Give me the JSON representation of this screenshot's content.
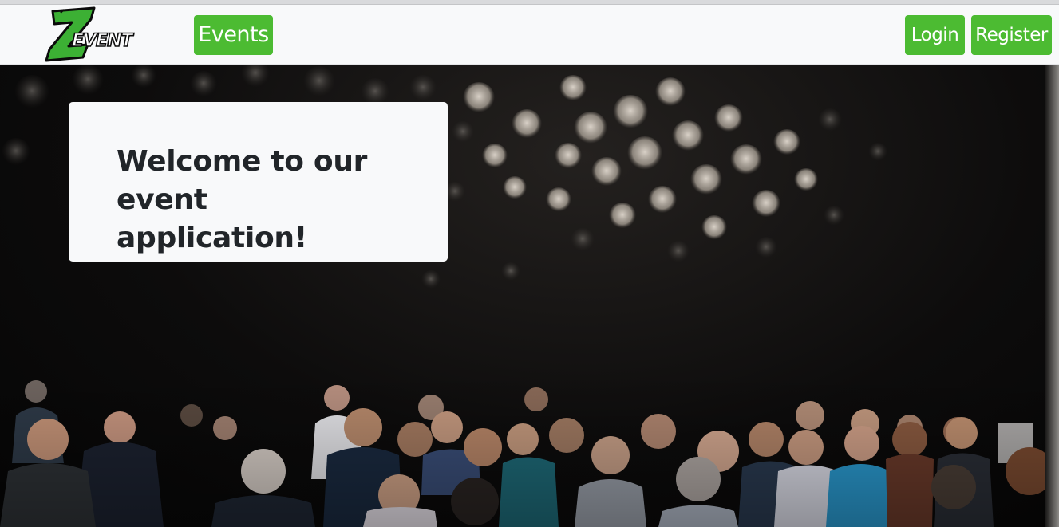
{
  "brand": {
    "logo_text": "EVENT",
    "logo_letter": "Z",
    "accent_color": "#4cbb32"
  },
  "nav": {
    "events_label": "Events",
    "login_label": "Login",
    "register_label": "Register"
  },
  "hero": {
    "title_line1": "Welcome to our",
    "title_line2": "event application!",
    "background_image": "conference-audience-photo"
  }
}
